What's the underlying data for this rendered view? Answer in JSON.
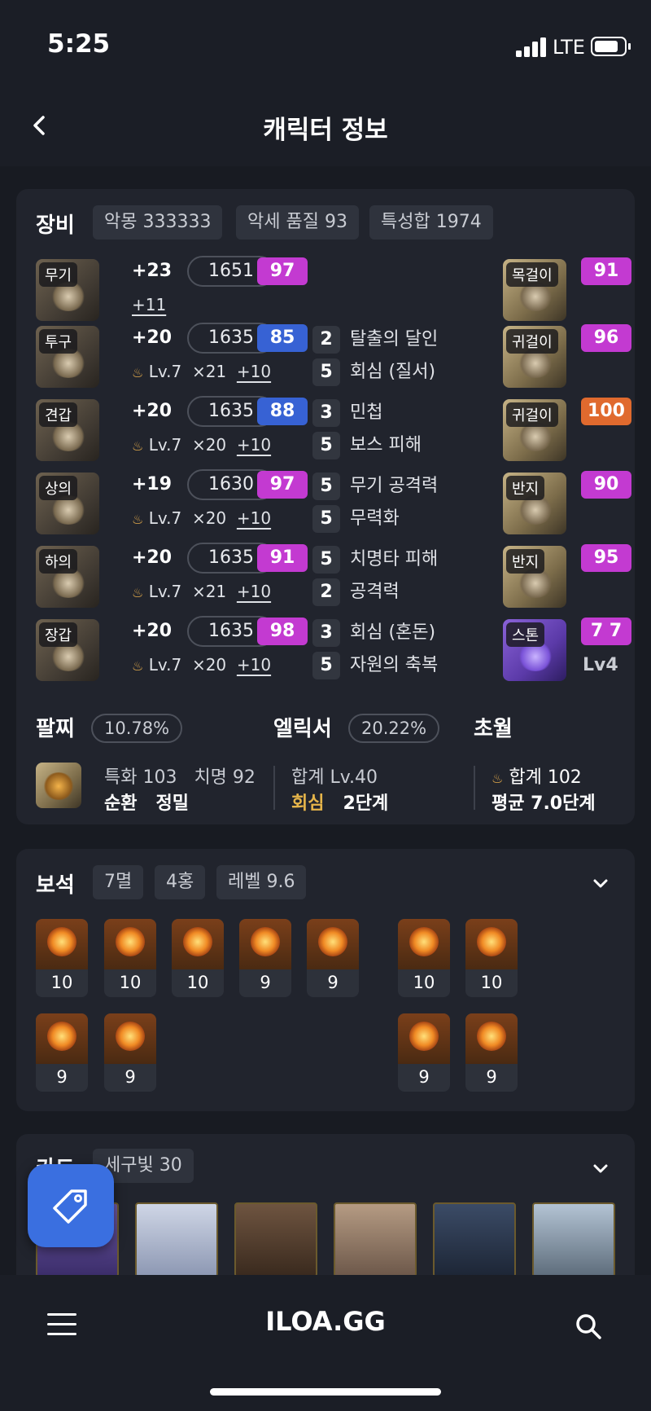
{
  "status": {
    "time": "5:25",
    "network": "LTE"
  },
  "header": {
    "title": "캐릭터 정보"
  },
  "equipment": {
    "title": "장비",
    "chips": [
      "악몽 333333",
      "악세 품질 93",
      "특성합 1974"
    ],
    "items": [
      {
        "slot": "무기",
        "refine": "+23",
        "ilvl": "1651",
        "quality": "97",
        "qcolor": "purple",
        "sub_extra": "+11"
      },
      {
        "slot": "투구",
        "refine": "+20",
        "ilvl": "1635",
        "quality": "85",
        "qcolor": "blue",
        "sub_lv": "Lv.7",
        "sub_x": "×21",
        "sub_plus": "+10"
      },
      {
        "slot": "견갑",
        "refine": "+20",
        "ilvl": "1635",
        "quality": "88",
        "qcolor": "blue",
        "sub_lv": "Lv.7",
        "sub_x": "×20",
        "sub_plus": "+10"
      },
      {
        "slot": "상의",
        "refine": "+19",
        "ilvl": "1630",
        "quality": "97",
        "qcolor": "purple",
        "sub_lv": "Lv.7",
        "sub_x": "×20",
        "sub_plus": "+10"
      },
      {
        "slot": "하의",
        "refine": "+20",
        "ilvl": "1635",
        "quality": "91",
        "qcolor": "purple",
        "sub_lv": "Lv.7",
        "sub_x": "×21",
        "sub_plus": "+10"
      },
      {
        "slot": "장갑",
        "refine": "+20",
        "ilvl": "1635",
        "quality": "98",
        "qcolor": "purple",
        "sub_lv": "Lv.7",
        "sub_x": "×20",
        "sub_plus": "+10"
      }
    ],
    "engravings": [
      {
        "n": "2",
        "name": "탈출의 달인"
      },
      {
        "n": "5",
        "name": "회심 (질서)"
      },
      {
        "n": "3",
        "name": "민첩"
      },
      {
        "n": "5",
        "name": "보스 피해"
      },
      {
        "n": "5",
        "name": "무기 공격력"
      },
      {
        "n": "5",
        "name": "무력화"
      },
      {
        "n": "5",
        "name": "치명타 피해"
      },
      {
        "n": "2",
        "name": "공격력"
      },
      {
        "n": "3",
        "name": "회심 (혼돈)"
      },
      {
        "n": "5",
        "name": "자원의 축복"
      }
    ],
    "accessories": [
      {
        "slot": "목걸이",
        "quality": "91",
        "qcolor": "purple"
      },
      {
        "slot": "귀걸이",
        "quality": "96",
        "qcolor": "purple"
      },
      {
        "slot": "귀걸이",
        "quality": "100",
        "qcolor": "orange"
      },
      {
        "slot": "반지",
        "quality": "90",
        "qcolor": "purple"
      },
      {
        "slot": "반지",
        "quality": "95",
        "qcolor": "purple"
      },
      {
        "slot": "스톤",
        "quality": "7 7",
        "qcolor": "purple",
        "lv": "Lv4"
      }
    ],
    "bracelet": {
      "label": "팔찌",
      "pct": "10.78%",
      "stats1": "특화 103   치명 92",
      "stats2a": "순환",
      "stats2b": "정밀"
    },
    "elixir": {
      "label": "엘릭서",
      "pct": "20.22%",
      "total": "합계 Lv.40",
      "effect": "회심",
      "stage": "2단계"
    },
    "transcend": {
      "label": "초월",
      "total": "합계 102",
      "avg": "평균 7.0단계"
    }
  },
  "gems": {
    "title": "보석",
    "chips": [
      "7멸",
      "4홍",
      "레벨 9.6"
    ],
    "row1_left": [
      "10",
      "10",
      "10",
      "9",
      "9"
    ],
    "row1_right": [
      "10",
      "10"
    ],
    "row2_left": [
      "9",
      "9"
    ],
    "row2_right": [
      "9",
      "9"
    ]
  },
  "cards": {
    "title": "카드",
    "chip": "세구빛 30"
  },
  "nav": {
    "brand": "ILOA.GG"
  },
  "colors": {
    "purple": "#c33ad1",
    "blue": "#3762d4",
    "orange": "#e06a2e",
    "bg": "#181b22",
    "card": "#21242d"
  }
}
